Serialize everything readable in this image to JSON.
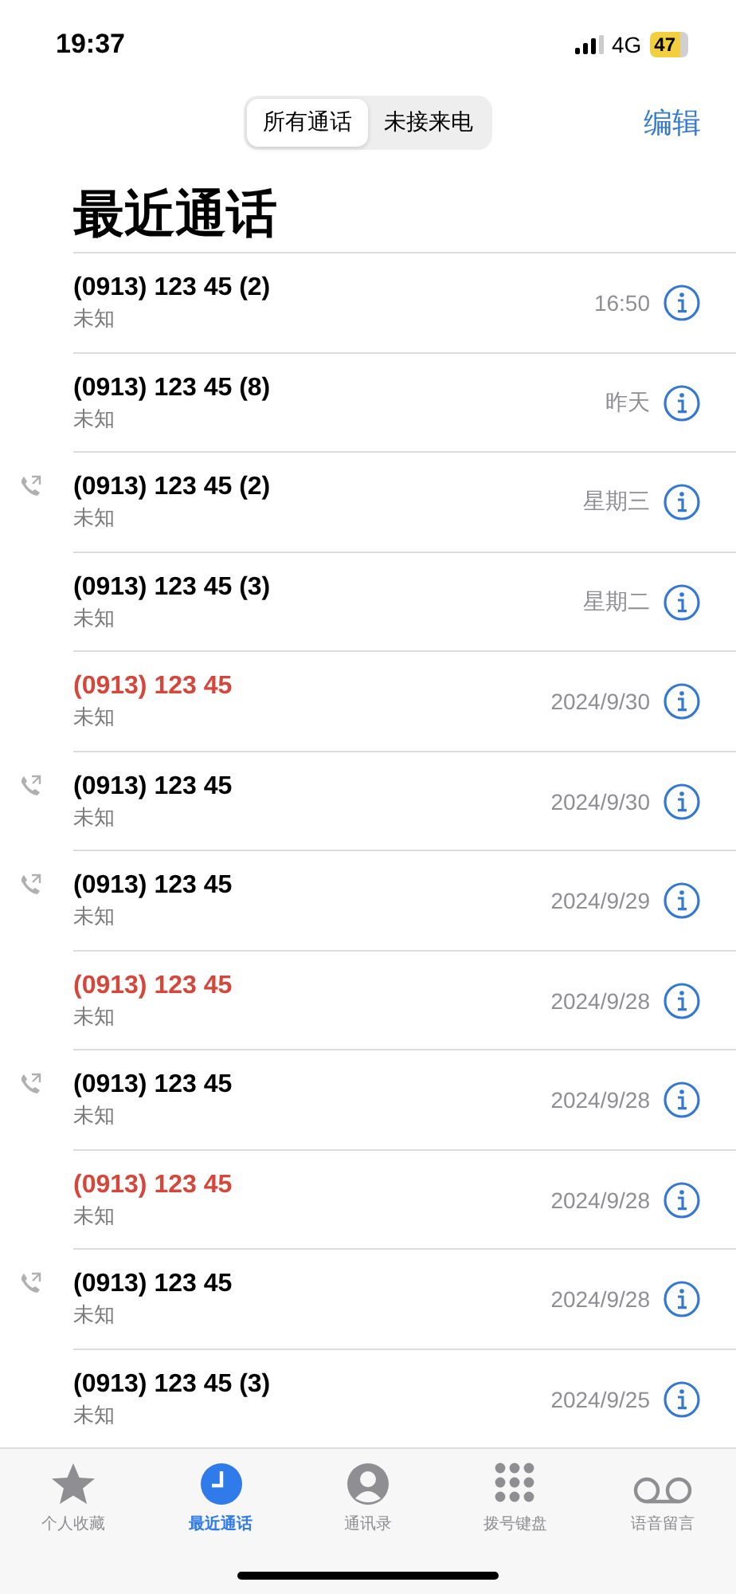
{
  "status_bar": {
    "time": "19:37",
    "network": "4G",
    "battery": "47"
  },
  "segments": [
    {
      "label": "所有通话",
      "selected": true
    },
    {
      "label": "未接来电",
      "selected": false
    }
  ],
  "edit_button": "编辑",
  "title": "最近通话",
  "calls": [
    {
      "number": "(0913) 123 45 (2)",
      "label": "未知",
      "time": "16:50",
      "outgoing": false,
      "missed": false
    },
    {
      "number": "(0913) 123 45 (8)",
      "label": "未知",
      "time": "昨天",
      "outgoing": false,
      "missed": false
    },
    {
      "number": "(0913) 123 45 (2)",
      "label": "未知",
      "time": "星期三",
      "outgoing": true,
      "missed": false
    },
    {
      "number": "(0913) 123 45 (3)",
      "label": "未知",
      "time": "星期二",
      "outgoing": false,
      "missed": false
    },
    {
      "number": "(0913) 123 45",
      "label": "未知",
      "time": "2024/9/30",
      "outgoing": false,
      "missed": true
    },
    {
      "number": "(0913) 123 45",
      "label": "未知",
      "time": "2024/9/30",
      "outgoing": true,
      "missed": false
    },
    {
      "number": "(0913) 123 45",
      "label": "未知",
      "time": "2024/9/29",
      "outgoing": true,
      "missed": false
    },
    {
      "number": "(0913) 123 45",
      "label": "未知",
      "time": "2024/9/28",
      "outgoing": false,
      "missed": true
    },
    {
      "number": "(0913) 123 45",
      "label": "未知",
      "time": "2024/9/28",
      "outgoing": true,
      "missed": false
    },
    {
      "number": "(0913) 123 45",
      "label": "未知",
      "time": "2024/9/28",
      "outgoing": false,
      "missed": true
    },
    {
      "number": "(0913) 123 45",
      "label": "未知",
      "time": "2024/9/28",
      "outgoing": true,
      "missed": false
    },
    {
      "number": "(0913) 123 45 (3)",
      "label": "未知",
      "time": "2024/9/25",
      "outgoing": false,
      "missed": false
    }
  ],
  "tab_bar": [
    {
      "kind": "star",
      "label": "个人收藏",
      "selected": false
    },
    {
      "kind": "clock",
      "label": "最近通话",
      "selected": true
    },
    {
      "kind": "person",
      "label": "通讯录",
      "selected": false
    },
    {
      "kind": "keypad",
      "label": "拨号键盘",
      "selected": false
    },
    {
      "kind": "voicemail",
      "label": "语音留言",
      "selected": false
    }
  ]
}
